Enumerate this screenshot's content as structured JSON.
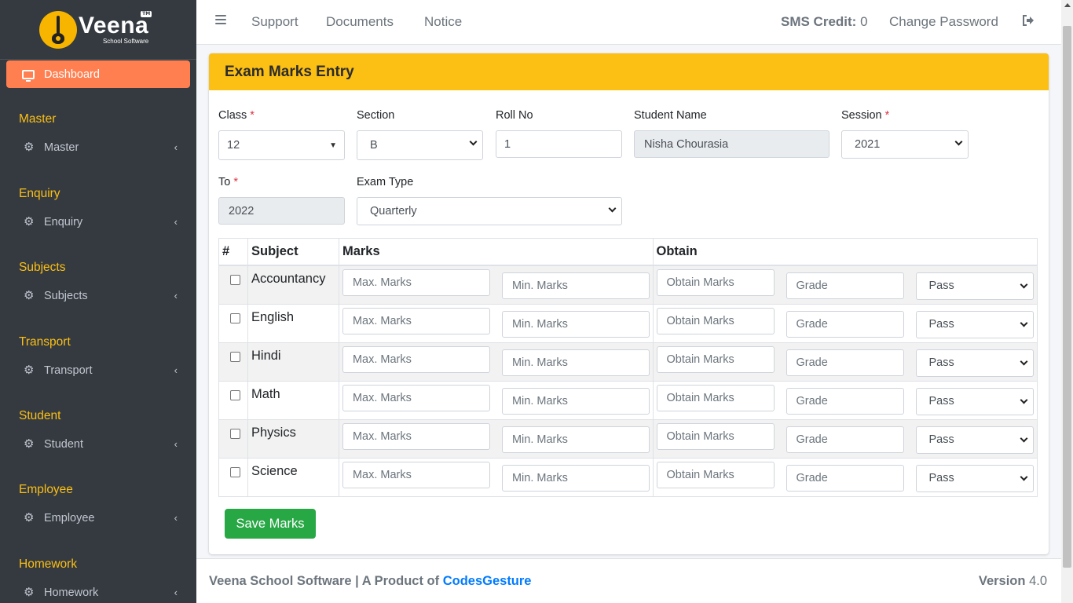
{
  "brand": {
    "name": "Veena",
    "subtitle": "School Software",
    "badge": "TM"
  },
  "sidebar": {
    "dashboard": "Dashboard",
    "sections": [
      {
        "header": "Master",
        "item": "Master"
      },
      {
        "header": "Enquiry",
        "item": "Enquiry"
      },
      {
        "header": "Subjects",
        "item": "Subjects"
      },
      {
        "header": "Transport",
        "item": "Transport"
      },
      {
        "header": "Student",
        "item": "Student"
      },
      {
        "header": "Employee",
        "item": "Employee"
      },
      {
        "header": "Homework",
        "item": "Homework"
      }
    ]
  },
  "topbar": {
    "links": [
      "Support",
      "Documents",
      "Notice"
    ],
    "sms_label": "SMS Credit:",
    "sms_value": "0",
    "change_password": "Change Password"
  },
  "card": {
    "title": "Exam Marks Entry"
  },
  "form": {
    "class_label": "Class",
    "class_value": "12",
    "section_label": "Section",
    "section_value": "B",
    "roll_label": "Roll No",
    "roll_value": "1",
    "student_label": "Student Name",
    "student_value": "Nisha Chourasia",
    "session_label": "Session",
    "session_value": "2021",
    "to_label": "To",
    "to_value": "2022",
    "exam_type_label": "Exam Type",
    "exam_type_value": "Quarterly",
    "required_mark": "*"
  },
  "table": {
    "headers": [
      "#",
      "Subject",
      "Marks",
      "Obtain"
    ],
    "placeholders": {
      "max": "Max. Marks",
      "min": "Min. Marks",
      "obtain": "Obtain Marks",
      "grade": "Grade"
    },
    "result_default": "Pass",
    "rows": [
      "Accountancy",
      "English",
      "Hindi",
      "Math",
      "Physics",
      "Science"
    ]
  },
  "save_button": "Save Marks",
  "footer": {
    "left_text": "Veena School Software | A Product of ",
    "left_link": "CodesGesture",
    "version_label": "Version",
    "version_value": "4.0"
  },
  "colors": {
    "accent": "#fcbf14",
    "sidebar_bg": "#343a40",
    "active": "#ff7f50",
    "success": "#28a745",
    "link": "#007bff"
  }
}
